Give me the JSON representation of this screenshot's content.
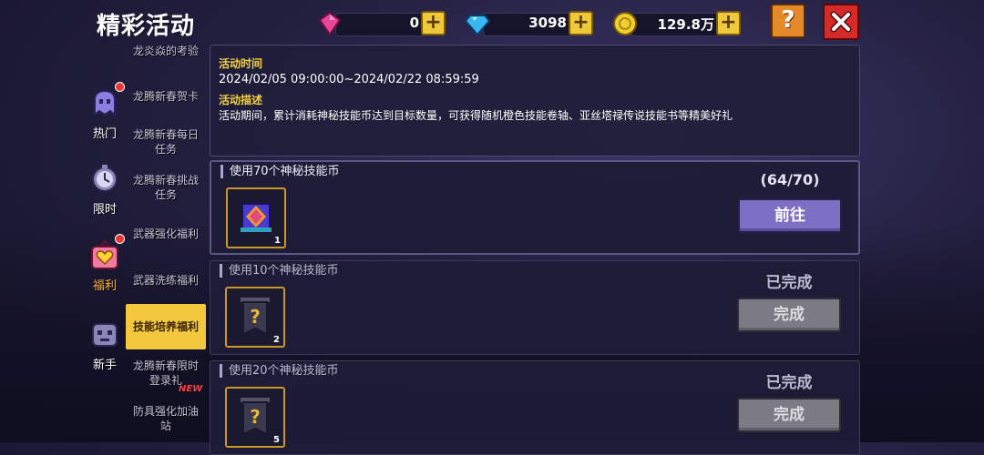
{
  "header": {
    "title": "精彩活动"
  },
  "currencies": [
    {
      "name": "pink-gem",
      "value": "0",
      "color": "#e8469a"
    },
    {
      "name": "blue-diamond",
      "value": "3098",
      "color": "#38b8f0"
    },
    {
      "name": "gold-coin",
      "value": "129.8万",
      "color": "#f0d030"
    }
  ],
  "buttons": {
    "help": "?",
    "add": "+"
  },
  "rail": [
    {
      "label": "热门",
      "icon": "ghost-icon",
      "badge": true,
      "active": false
    },
    {
      "label": "限时",
      "icon": "clock-icon",
      "badge": false,
      "active": false
    },
    {
      "label": "福利",
      "icon": "gift-heart-icon",
      "badge": true,
      "active": true
    },
    {
      "label": "新手",
      "icon": "robot-icon",
      "badge": false,
      "active": false
    }
  ],
  "subnav": [
    {
      "label": "龙炎焱的考验"
    },
    {
      "label": "龙腾新春贺卡"
    },
    {
      "label": "龙腾新春每日任务"
    },
    {
      "label": "龙腾新春挑战任务"
    },
    {
      "label": "武器强化福利"
    },
    {
      "label": "武器洗练福利"
    },
    {
      "label": "技能培养福利"
    },
    {
      "label": "龙腾新春限时登录礼"
    },
    {
      "label": "防具强化加油站"
    }
  ],
  "new_tag": "NEW",
  "info": {
    "time_heading": "活动时间",
    "time_value": "2024/02/05 09:00:00~2024/02/22 08:59:59",
    "desc_heading": "活动描述",
    "desc_value": "活动期间，累计消耗神秘技能币达到目标数量，可获得随机橙色技能卷轴、亚丝塔禄传说技能书等精美好礼"
  },
  "tasks": [
    {
      "title": "使用70个神秘技能币",
      "reward_icon": "skill-book-icon",
      "reward_count": "1",
      "progress": "(64/70)",
      "button": "前往",
      "completed": false
    },
    {
      "title": "使用10个神秘技能币",
      "reward_icon": "mystery-scroll-icon",
      "reward_count": "2",
      "status": "已完成",
      "button": "完成",
      "completed": true
    },
    {
      "title": "使用20个神秘技能币",
      "reward_icon": "mystery-scroll-icon",
      "reward_count": "5",
      "status": "已完成",
      "button": "完成",
      "completed": true
    }
  ]
}
